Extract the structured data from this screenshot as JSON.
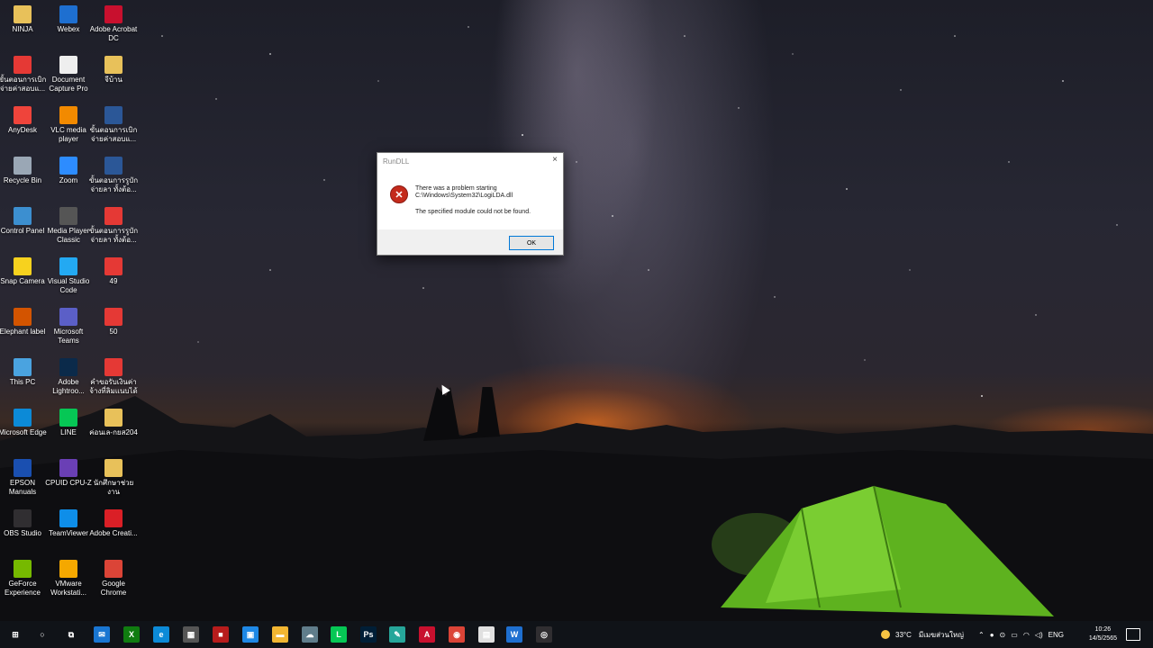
{
  "desktop": {
    "icons": [
      {
        "label": "NINJA",
        "icon": "folder-icon",
        "color": "#e8c15a"
      },
      {
        "label": "Webex",
        "icon": "webex-icon",
        "color": "#1e6fd0"
      },
      {
        "label": "Adobe Acrobat DC",
        "icon": "acrobat-icon",
        "color": "#c8102e"
      },
      {
        "label": "ขั้นตอนการเบิกจ่ายค่าสอบแ...",
        "icon": "pdf-icon",
        "color": "#e53935"
      },
      {
        "label": "Document Capture Pro",
        "icon": "document-icon",
        "color": "#eeeeee"
      },
      {
        "label": "จีบ้าน",
        "icon": "folder-zip-icon",
        "color": "#e8c15a"
      },
      {
        "label": "AnyDesk",
        "icon": "anydesk-icon",
        "color": "#ef443b"
      },
      {
        "label": "VLC media player",
        "icon": "vlc-icon",
        "color": "#f28a00"
      },
      {
        "label": "ขั้นตอนการเบิกจ่ายค่าสอบแ...",
        "icon": "word-icon",
        "color": "#2b5797"
      },
      {
        "label": "Recycle Bin",
        "icon": "recycle-bin-icon",
        "color": "#9aa7b5"
      },
      {
        "label": "Zoom",
        "icon": "zoom-icon",
        "color": "#2d8cff"
      },
      {
        "label": "ขั้นตอนการรูบักจ่ายลา ทั้งต้อ...",
        "icon": "word-icon",
        "color": "#2b5797"
      },
      {
        "label": "Control Panel",
        "icon": "control-panel-icon",
        "color": "#3c8fd0"
      },
      {
        "label": "Media Player Classic",
        "icon": "media-player-icon",
        "color": "#555555"
      },
      {
        "label": "ขั้นตอนการรูบักจ่ายลา ทั้งต้อ...",
        "icon": "pdf-icon",
        "color": "#e53935"
      },
      {
        "label": "Snap Camera",
        "icon": "snap-camera-icon",
        "color": "#f7d21e"
      },
      {
        "label": "Visual Studio Code",
        "icon": "vscode-icon",
        "color": "#23a9f2"
      },
      {
        "label": "49",
        "icon": "pdf-icon",
        "color": "#e53935"
      },
      {
        "label": "Elephant label",
        "icon": "elephant-label-icon",
        "color": "#d35400"
      },
      {
        "label": "Microsoft Teams",
        "icon": "teams-icon",
        "color": "#5b5fc7"
      },
      {
        "label": "50",
        "icon": "pdf-icon",
        "color": "#e53935"
      },
      {
        "label": "This PC",
        "icon": "this-pc-icon",
        "color": "#4aa3e0"
      },
      {
        "label": "Adobe Lightroo...",
        "icon": "lightroom-icon",
        "color": "#0b2a4a"
      },
      {
        "label": "คำขอรับเงินค่าจ้างที่ลิมแนบได้",
        "icon": "pdf-icon",
        "color": "#e53935"
      },
      {
        "label": "Microsoft Edge",
        "icon": "edge-icon",
        "color": "#0c8ad7"
      },
      {
        "label": "LINE",
        "icon": "line-icon",
        "color": "#06c755"
      },
      {
        "label": "ค่อนเล-กยส204",
        "icon": "folder-zip-icon",
        "color": "#e8c15a"
      },
      {
        "label": "EPSON Manuals",
        "icon": "epson-icon",
        "color": "#1a4fb0"
      },
      {
        "label": "CPUID CPU-Z",
        "icon": "cpuz-icon",
        "color": "#6a3fb5"
      },
      {
        "label": "นักศึกษาช่วยงาน",
        "icon": "folder-zip-icon",
        "color": "#e8c15a"
      },
      {
        "label": "OBS Studio",
        "icon": "obs-icon",
        "color": "#302e31"
      },
      {
        "label": "TeamViewer",
        "icon": "teamviewer-icon",
        "color": "#0e8ee9"
      },
      {
        "label": "Adobe Creati...",
        "icon": "creative-cloud-icon",
        "color": "#da1f26"
      },
      {
        "label": "GeForce Experience",
        "icon": "geforce-icon",
        "color": "#76b900"
      },
      {
        "label": "VMware Workstati...",
        "icon": "vmware-icon",
        "color": "#f5a800"
      },
      {
        "label": "Google Chrome",
        "icon": "chrome-icon",
        "color": "#db4437"
      }
    ]
  },
  "dialog": {
    "title": "RunDLL",
    "close_glyph": "×",
    "error_icon": "error-icon",
    "line1": "There was a problem starting",
    "line2": "C:\\Windows\\System32\\LogiLDA.dll",
    "line3": "The specified module could not be found.",
    "ok_label": "OK"
  },
  "taskbar": {
    "apps": [
      {
        "name": "start-button",
        "glyph": "⊞",
        "color": "transparent"
      },
      {
        "name": "search-button",
        "glyph": "○",
        "color": "transparent"
      },
      {
        "name": "task-view-button",
        "glyph": "⧉",
        "color": "transparent"
      },
      {
        "name": "mail-app",
        "glyph": "✉",
        "color": "#1976d2"
      },
      {
        "name": "xbox-app",
        "glyph": "X",
        "color": "#107c10"
      },
      {
        "name": "edge-app",
        "glyph": "e",
        "color": "#0c8ad7"
      },
      {
        "name": "calculator-app",
        "glyph": "▦",
        "color": "#555"
      },
      {
        "name": "red-app",
        "glyph": "■",
        "color": "#b71c1c"
      },
      {
        "name": "store-app",
        "glyph": "▣",
        "color": "#1e88e5"
      },
      {
        "name": "file-explorer-app",
        "glyph": "▬",
        "color": "#f2b632"
      },
      {
        "name": "cloud-app",
        "glyph": "☁",
        "color": "#607d8b"
      },
      {
        "name": "line-app",
        "glyph": "L",
        "color": "#06c755"
      },
      {
        "name": "photoshop-app",
        "glyph": "Ps",
        "color": "#001e36"
      },
      {
        "name": "notes-app",
        "glyph": "✎",
        "color": "#26a69a"
      },
      {
        "name": "acrobat-app",
        "glyph": "A",
        "color": "#c8102e"
      },
      {
        "name": "chrome-app",
        "glyph": "◉",
        "color": "#db4437"
      },
      {
        "name": "notepad-app",
        "glyph": "▤",
        "color": "#e0e0e0"
      },
      {
        "name": "webex-app",
        "glyph": "W",
        "color": "#1e6fd0"
      },
      {
        "name": "obs-app",
        "glyph": "◎",
        "color": "#302e31"
      }
    ],
    "weather_temp": "33°C",
    "weather_text": "มีเมฆส่วนใหญ่",
    "language": "ENG",
    "time": "10:26",
    "date": "14/5/2565"
  }
}
